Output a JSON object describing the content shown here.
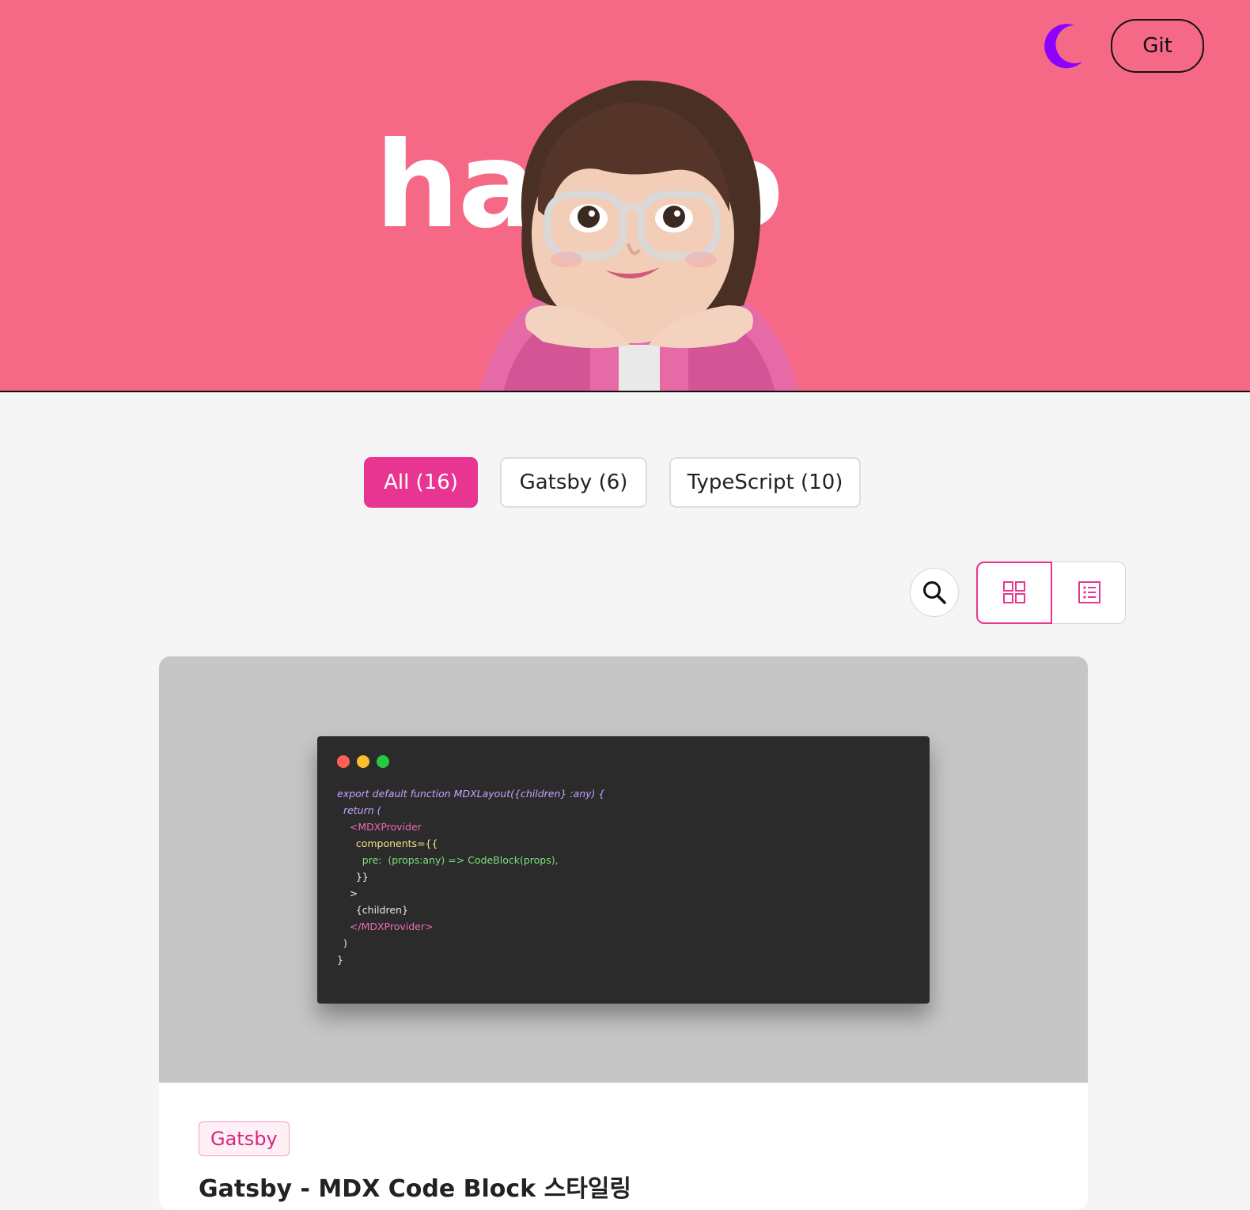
{
  "header": {
    "title": "hanno",
    "git_label": "Git",
    "theme_icon": "moon-icon",
    "background_color": "#f56886",
    "moon_color": "#8b00ff"
  },
  "categories": [
    {
      "label": "All (16)",
      "active": true
    },
    {
      "label": "Gatsby (6)",
      "active": false
    },
    {
      "label": "TypeScript (10)",
      "active": false
    }
  ],
  "toolbar": {
    "search_icon": "search-icon",
    "grid_icon": "grid-view-icon",
    "list_icon": "list-view-icon",
    "active_view": "grid"
  },
  "posts": [
    {
      "tag": "Gatsby",
      "title": "Gatsby - MDX Code Block 스타일링",
      "thumbnail_code": [
        "export default function MDXLayout({children} :any) {",
        "  return (",
        "    <MDXProvider",
        "      components={{",
        "        pre:  (props:any) => CodeBlock(props),",
        "      }}",
        "    >",
        "      {children}",
        "    </MDXProvider>",
        "  )",
        "}"
      ]
    }
  ],
  "colors": {
    "accent": "#e83591",
    "page_bg": "#f5f5f5"
  }
}
